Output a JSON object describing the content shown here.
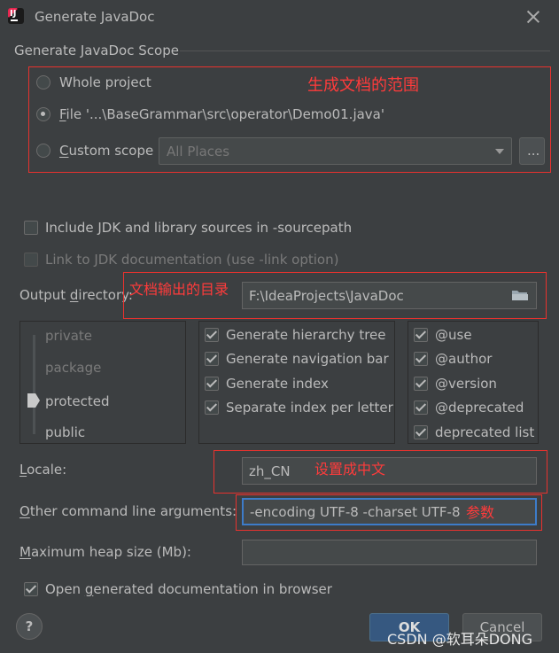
{
  "window": {
    "title": "Generate JavaDoc"
  },
  "scope": {
    "section_title": "Generate JavaDoc Scope",
    "whole_project": "Whole project",
    "file_prefix": "F",
    "file_rest": "ile '...\\BaseGrammar\\src\\operator\\Demo01.java'",
    "custom_scope_prefix": "C",
    "custom_scope_rest": "ustom scope",
    "custom_scope_value": "All Places",
    "browse_label": "...",
    "selected": "file",
    "annotation": "生成文档的范围"
  },
  "options": {
    "include_jdk": {
      "label": "Include JDK and library sources in -sourcepath",
      "checked": false
    },
    "link_jdk": {
      "label": "Link to JDK documentation (use -link option)",
      "checked": false,
      "enabled": false
    }
  },
  "output": {
    "label_a": "Output ",
    "label_u": "d",
    "label_b": "irectory:",
    "value": "F:\\IdeaProjects\\JavaDoc",
    "annotation": "文档输出的目录"
  },
  "visibility": {
    "levels": [
      "private",
      "package",
      "protected",
      "public"
    ],
    "selected": "protected"
  },
  "generate": [
    {
      "label": "Generate hierarchy tree",
      "checked": true
    },
    {
      "label": "Generate navigation bar",
      "checked": true
    },
    {
      "label": "Generate index",
      "checked": true
    },
    {
      "label": "Separate index per letter",
      "checked": true
    }
  ],
  "tags": [
    {
      "label": "@use",
      "checked": true
    },
    {
      "label": "@author",
      "checked": true
    },
    {
      "label": "@version",
      "checked": true
    },
    {
      "label": "@deprecated",
      "checked": true
    },
    {
      "label": "deprecated list",
      "checked": true
    }
  ],
  "locale": {
    "label_u": "L",
    "label_rest": "ocale:",
    "value": "zh_CN",
    "annotation": "设置成中文"
  },
  "args": {
    "label_u": "O",
    "label_rest": "ther command line arguments:",
    "value": "-encoding UTF-8 -charset UTF-8",
    "annotation": "参数"
  },
  "heap": {
    "label_u": "M",
    "label_rest": "aximum heap size (Mb):",
    "value": ""
  },
  "open_browser": {
    "label_a": "Open ",
    "label_u": "g",
    "label_b": "enerated documentation in browser",
    "checked": true
  },
  "buttons": {
    "help": "?",
    "ok": "OK",
    "cancel": "Cancel"
  },
  "watermark": "CSDN @软耳朵DONG",
  "colors": {
    "background": "#3c3f41",
    "annotation_red": "#e8322e",
    "focus_blue": "#3d7cc9",
    "ok_blue": "#365880"
  }
}
